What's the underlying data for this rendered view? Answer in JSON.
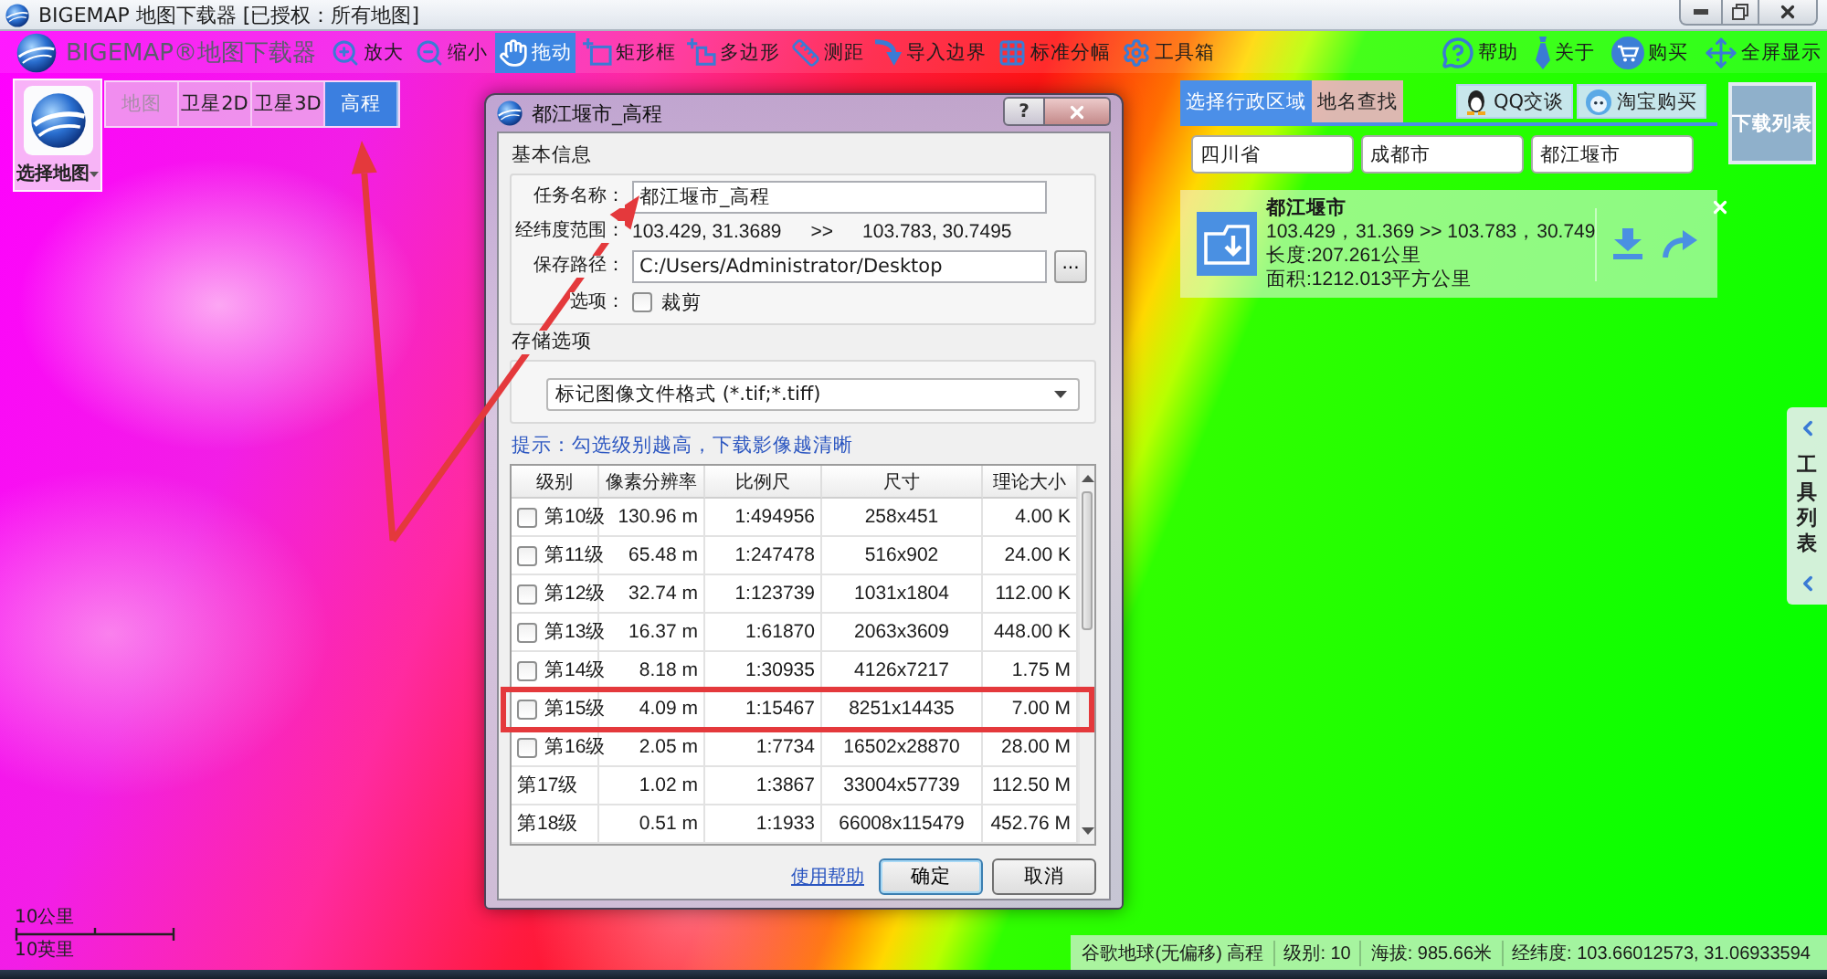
{
  "window": {
    "title": "BIGEMAP 地图下载器 [已授权：所有地图]"
  },
  "toolbar": {
    "logo": "BIGEMAP®地图下载器",
    "tools": [
      {
        "label": "放大",
        "selected": false
      },
      {
        "label": "缩小",
        "selected": false
      },
      {
        "label": "拖动",
        "selected": true
      },
      {
        "label": "矩形框",
        "selected": false
      },
      {
        "label": "多边形",
        "selected": false
      },
      {
        "label": "测距",
        "selected": false
      },
      {
        "label": "导入边界",
        "selected": false
      },
      {
        "label": "标准分幅",
        "selected": false
      },
      {
        "label": "工具箱",
        "selected": false
      }
    ],
    "right_tools": [
      "帮助",
      "关于",
      "购买",
      "全屏显示"
    ]
  },
  "map_picker": {
    "label": "选择地图"
  },
  "map_sources": [
    {
      "label": "地图",
      "selected": false,
      "disabled": true
    },
    {
      "label": "卫星2D",
      "selected": false,
      "disabled": false
    },
    {
      "label": "卫星3D",
      "selected": false,
      "disabled": false
    },
    {
      "label": "高程",
      "selected": true,
      "disabled": false
    }
  ],
  "region_panel": {
    "tabs": [
      {
        "label": "选择行政区域",
        "selected": true
      },
      {
        "label": "地名查找",
        "selected": false
      }
    ],
    "links": [
      "QQ交谈",
      "淘宝购买"
    ],
    "selectors": [
      "四川省",
      "成都市",
      "都江堰市"
    ],
    "result": {
      "name": "都江堰市",
      "range": "103.429，31.369 >> 103.783，30.749",
      "length": "长度:207.261公里",
      "area": "面积:1212.013平方公里"
    }
  },
  "download_list": {
    "label": "下载列表"
  },
  "side_tab": {
    "label": "工具列表"
  },
  "dialog": {
    "title": "都江堰市_高程",
    "help_button": "?",
    "basic_info": {
      "heading": "基本信息",
      "task_name": {
        "label": "任务名称：",
        "value": "都江堰市_高程"
      },
      "range": {
        "label": "经纬度范围：",
        "from": "103.429, 31.3689",
        "separator": ">>",
        "to": "103.783, 30.7495"
      },
      "save_path": {
        "label": "保存路径：",
        "value": "C:/Users/Administrator/Desktop",
        "browse": "..."
      },
      "options": {
        "label": "选项：",
        "crop": {
          "label": "裁剪",
          "checked": false
        }
      }
    },
    "storage": {
      "heading": "存储选项",
      "format": "标记图像文件格式 (*.tif;*.tiff)"
    },
    "hint": "提示：勾选级别越高，下载影像越清晰",
    "table": {
      "columns": [
        "级别",
        "像素分辨率",
        "比例尺",
        "尺寸",
        "理论大小"
      ],
      "rows": [
        {
          "kind": "checkbox",
          "checked": false,
          "marked": false,
          "cells": [
            "第10级",
            "130.96 m",
            "1:494956",
            "258x451",
            "4.00 K"
          ]
        },
        {
          "kind": "checkbox",
          "checked": false,
          "marked": false,
          "cells": [
            "第11级",
            "65.48 m",
            "1:247478",
            "516x902",
            "24.00 K"
          ]
        },
        {
          "kind": "checkbox",
          "checked": false,
          "marked": false,
          "cells": [
            "第12级",
            "32.74 m",
            "1:123739",
            "1031x1804",
            "112.00 K"
          ]
        },
        {
          "kind": "checkbox",
          "checked": false,
          "marked": false,
          "cells": [
            "第13级",
            "16.37 m",
            "1:61870",
            "2063x3609",
            "448.00 K"
          ]
        },
        {
          "kind": "checkbox",
          "checked": false,
          "marked": false,
          "cells": [
            "第14级",
            "8.18 m",
            "1:30935",
            "4126x7217",
            "1.75 M"
          ]
        },
        {
          "kind": "checkbox",
          "checked": false,
          "marked": true,
          "cells": [
            "第15级",
            "4.09 m",
            "1:15467",
            "8251x14435",
            "7.00 M"
          ]
        },
        {
          "kind": "checkbox",
          "checked": false,
          "marked": false,
          "cells": [
            "第16级",
            "2.05 m",
            "1:7734",
            "16502x28870",
            "28.00 M"
          ]
        },
        {
          "kind": "plain",
          "marked": false,
          "cells": [
            "第17级",
            "1.02 m",
            "1:3867",
            "33004x57739",
            "112.50 M"
          ]
        },
        {
          "kind": "plain",
          "marked": false,
          "cells": [
            "第18级",
            "0.51 m",
            "1:1933",
            "66008x115479",
            "452.76 M"
          ]
        }
      ]
    },
    "help_link": "使用帮助",
    "buttons": [
      {
        "label": "确定",
        "default": true
      },
      {
        "label": "取消",
        "default": false
      }
    ]
  },
  "status_bar": [
    "谷歌地球(无偏移) 高程",
    "级别: 10",
    "海拔: 985.66米",
    "经纬度: 103.66012573, 31.06933594"
  ],
  "scale": {
    "metric": "10公里",
    "imperial": "10英里"
  }
}
